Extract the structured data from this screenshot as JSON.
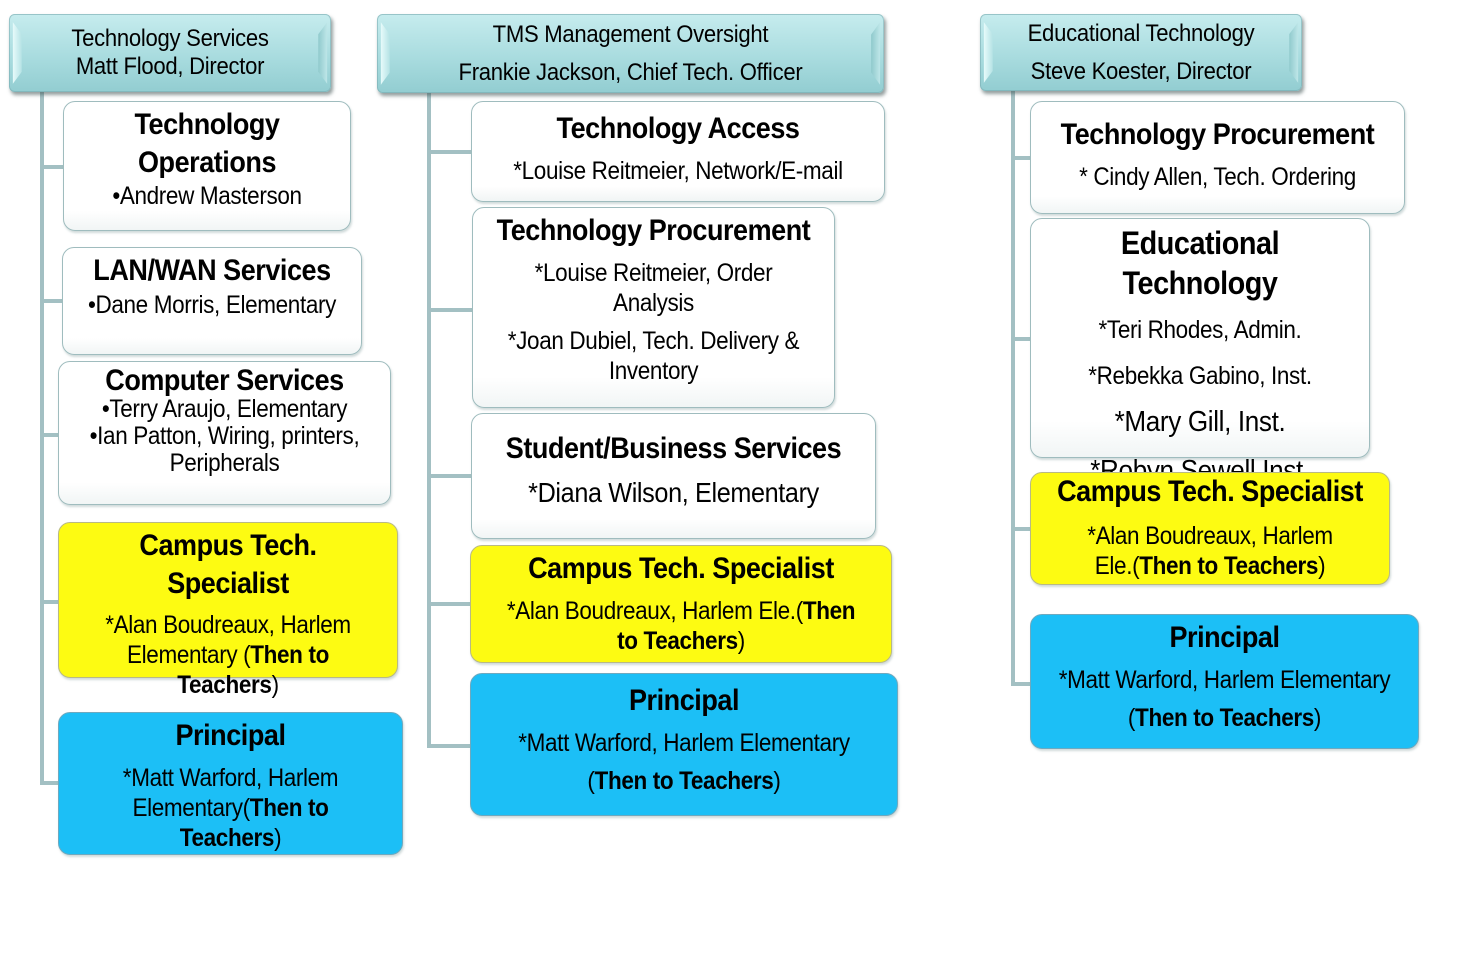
{
  "columns": [
    {
      "header": {
        "line1": "Technology Services",
        "line2": "Matt Flood, Director"
      },
      "units": [
        {
          "title": "Technology Operations",
          "title_lines": [
            "Technology",
            "Operations"
          ],
          "members": [
            "•Andrew Masterson"
          ],
          "style": "white"
        },
        {
          "title": "LAN/WAN Services",
          "members": [
            "•Dane Morris, Elementary"
          ],
          "style": "white"
        },
        {
          "title": "Computer Services",
          "members": [
            "•Terry Araujo, Elementary",
            "•Ian Patton, Wiring, printers,",
            "Peripherals"
          ],
          "style": "white"
        },
        {
          "title": "Campus Tech. Specialist",
          "members": [
            "*Alan Boudreaux, Harlem",
            "Elementary (",
            "Then to",
            "Teachers",
            ")"
          ],
          "style": "yellow"
        },
        {
          "title": "Principal",
          "members": [
            "*Matt Warford, Harlem",
            "Elementary(",
            "Then to",
            "Teachers",
            ")"
          ],
          "style": "blue"
        }
      ]
    },
    {
      "header": {
        "line1": "TMS Management Oversight",
        "line2": "Frankie Jackson, Chief Tech. Officer"
      },
      "units": [
        {
          "title": "Technology Access",
          "members": [
            "*Louise Reitmeier, Network/E-mail"
          ],
          "style": "white"
        },
        {
          "title": "Technology Procurement",
          "members": [
            "*Louise Reitmeier, Order",
            "Analysis",
            "*Joan Dubiel, Tech. Delivery &",
            "Inventory"
          ],
          "style": "white"
        },
        {
          "title": "Student/Business Services",
          "members": [
            "*Diana Wilson, Elementary"
          ],
          "style": "white"
        },
        {
          "title": "Campus Tech. Specialist",
          "members": [
            "*Alan Boudreaux, Harlem Ele.(",
            "Then",
            "to Teachers",
            ")"
          ],
          "style": "yellow"
        },
        {
          "title": "Principal",
          "members": [
            "*Matt Warford, Harlem Elementary",
            "(",
            "Then to Teachers",
            ")"
          ],
          "style": "blue"
        }
      ]
    },
    {
      "header": {
        "line1": "Educational Technology",
        "line2": "Steve Koester, Director"
      },
      "units": [
        {
          "title": "Technology Procurement",
          "members": [
            "* Cindy Allen, Tech. Ordering"
          ],
          "style": "white"
        },
        {
          "title": "Educational Technology",
          "members": [
            "*Teri Rhodes, Admin.",
            "*Rebekka Gabino, Inst.",
            "*Mary Gill, Inst.",
            "*Robyn Sewell Inst."
          ],
          "style": "white"
        },
        {
          "title": "Campus Tech. Specialist",
          "members": [
            "*Alan Boudreaux, Harlem",
            "Ele.(",
            "Then to Teachers",
            ")"
          ],
          "style": "yellow"
        },
        {
          "title": "Principal",
          "members": [
            "*Matt Warford, Harlem Elementary",
            "(",
            "Then to Teachers",
            ")"
          ],
          "style": "blue"
        }
      ]
    }
  ],
  "colors": {
    "header": "#a9dcdf",
    "connector": "#a3c0c3",
    "yellow": "#fdfb12",
    "blue": "#1cbff6",
    "white": "#ffffff"
  }
}
